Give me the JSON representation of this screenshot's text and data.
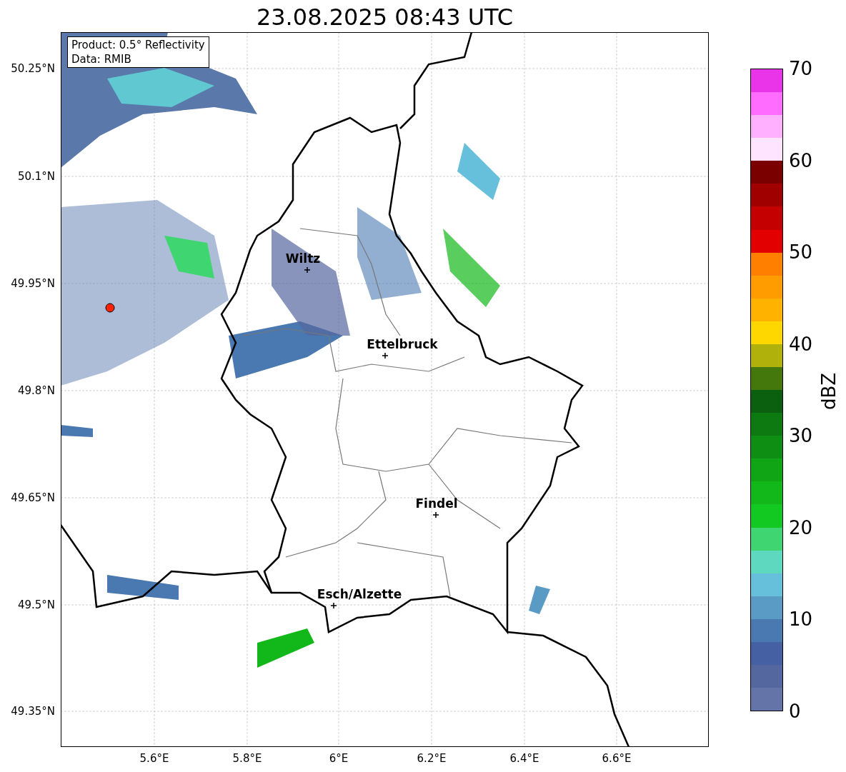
{
  "title": "23.08.2025 08:43 UTC",
  "info_box": [
    "Product: 0.5° Reflectivity",
    "Data: RMIB"
  ],
  "cities": [
    {
      "name": "Wiltz"
    },
    {
      "name": "Ettelbruck"
    },
    {
      "name": "Findel"
    },
    {
      "name": "Esch/Alzette"
    }
  ],
  "lat_ticks": [
    "50.25°N",
    "50.1°N",
    "49.95°N",
    "49.8°N",
    "49.65°N",
    "49.5°N",
    "49.35°N"
  ],
  "lon_ticks": [
    "5.6°E",
    "5.8°E",
    "6°E",
    "6.2°E",
    "6.4°E",
    "6.6°E"
  ],
  "colorbar": {
    "label": "dBZ",
    "ticks": [
      "70",
      "60",
      "50",
      "40",
      "30",
      "20",
      "10",
      "0"
    ],
    "bins": [
      {
        "color": "#e934e9"
      },
      {
        "color": "#ff6cff"
      },
      {
        "color": "#ffb0ff"
      },
      {
        "color": "#ffe4ff"
      },
      {
        "color": "#7a0000"
      },
      {
        "color": "#a00000"
      },
      {
        "color": "#c40000"
      },
      {
        "color": "#e30000"
      },
      {
        "color": "#ff7f00"
      },
      {
        "color": "#ff9c00"
      },
      {
        "color": "#ffb300"
      },
      {
        "color": "#ffd700"
      },
      {
        "color": "#b0b10a"
      },
      {
        "color": "#44770c"
      },
      {
        "color": "#0a600e"
      },
      {
        "color": "#0c7a10"
      },
      {
        "color": "#0e8e12"
      },
      {
        "color": "#10a514"
      },
      {
        "color": "#12b81a"
      },
      {
        "color": "#12c921"
      },
      {
        "color": "#3fd672"
      },
      {
        "color": "#5fd8c0"
      },
      {
        "color": "#66c0dc"
      },
      {
        "color": "#5a9bc6"
      },
      {
        "color": "#4a78b0"
      },
      {
        "color": "#4561a3"
      },
      {
        "color": "#55679f"
      },
      {
        "color": "#6474a8"
      }
    ]
  }
}
